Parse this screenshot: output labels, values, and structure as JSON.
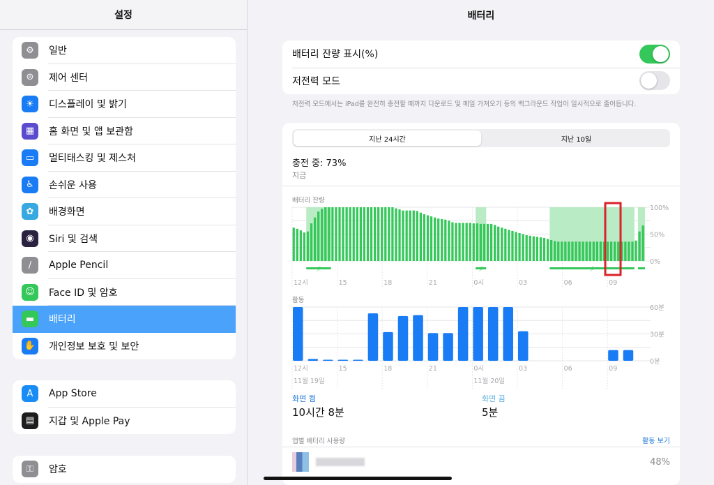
{
  "sidebar": {
    "title": "설정",
    "groups": [
      {
        "items": [
          {
            "label": "일반",
            "icon": "gear-icon",
            "color": "#8e8e93",
            "glyph": "⚙"
          },
          {
            "label": "제어 센터",
            "icon": "control-center-icon",
            "color": "#8e8e93",
            "glyph": "⊜"
          },
          {
            "label": "디스플레이 및 밝기",
            "icon": "brightness-icon",
            "color": "#1a7cf5",
            "glyph": "☀"
          },
          {
            "label": "홈 화면 및 앱 보관함",
            "icon": "home-screen-icon",
            "color": "#5b4ccf",
            "glyph": "▦"
          },
          {
            "label": "멀티태스킹 및 제스처",
            "icon": "multitasking-icon",
            "color": "#1a7cf5",
            "glyph": "▭"
          },
          {
            "label": "손쉬운 사용",
            "icon": "accessibility-icon",
            "color": "#1a7cf5",
            "glyph": "♿"
          },
          {
            "label": "배경화면",
            "icon": "wallpaper-icon",
            "color": "#38a9e0",
            "glyph": "✿"
          },
          {
            "label": "Siri 및 검색",
            "icon": "siri-icon",
            "color": "#2b2240",
            "glyph": "◉"
          },
          {
            "label": "Apple Pencil",
            "icon": "pencil-icon",
            "color": "#8e8e93",
            "glyph": "/"
          },
          {
            "label": "Face ID 및 암호",
            "icon": "face-id-icon",
            "color": "#34c759",
            "glyph": "☺"
          },
          {
            "label": "배터리",
            "icon": "battery-icon",
            "color": "#34c759",
            "glyph": "▬",
            "selected": true
          },
          {
            "label": "개인정보 보호 및 보안",
            "icon": "hand-icon",
            "color": "#1a7cf5",
            "glyph": "✋"
          }
        ]
      },
      {
        "items": [
          {
            "label": "App Store",
            "icon": "app-store-icon",
            "color": "#1a8cf5",
            "glyph": "A"
          },
          {
            "label": "지갑 및 Apple Pay",
            "icon": "wallet-icon",
            "color": "#1c1c1e",
            "glyph": "▤"
          }
        ]
      },
      {
        "items": [
          {
            "label": "암호",
            "icon": "key-icon",
            "color": "#8e8e93",
            "glyph": "⚿"
          }
        ]
      }
    ]
  },
  "main": {
    "title": "배터리",
    "toggles": [
      {
        "label": "배터리 잔량 표시(%)",
        "on": true
      },
      {
        "label": "저전력 모드",
        "on": false
      }
    ],
    "low_power_note": "저전력 모드에서는 iPad를 완전히 충전할 때까지 다운로드 및 메일 가져오기 등의 백그라운드 작업이 일시적으로 줄어듭니다.",
    "tabs": [
      {
        "label": "지난 24시간",
        "active": true
      },
      {
        "label": "지난 10일",
        "active": false
      }
    ],
    "status": {
      "title": "충전 중: 73%",
      "subtitle": "지금"
    },
    "battery_chart_label": "배터리 잔량",
    "activity_chart_label": "활동",
    "date_labels": [
      "11월 19일",
      "11월 20일"
    ],
    "stats": [
      {
        "label": "화면 켬",
        "value": "10시간 8분",
        "color": "#1e78d8"
      },
      {
        "label": "화면 끔",
        "value": "5분",
        "color": "#5ab0e0"
      }
    ],
    "app_usage": {
      "header": "앱별 배터리 사용량",
      "link": "활동 보기",
      "apps": [
        {
          "name": "",
          "percent": "48%"
        }
      ]
    }
  },
  "chart_data": [
    {
      "type": "bar",
      "title": "배터리 잔량",
      "x_ticks": [
        "12시",
        "15",
        "18",
        "21",
        "0시",
        "03",
        "06",
        "09"
      ],
      "y_ticks": [
        "100%",
        "50%",
        "0%"
      ],
      "ylim": [
        0,
        100
      ],
      "color": "#34c759",
      "charging_color": "#b9ebc4",
      "charging_periods": [
        [
          4,
          11
        ],
        [
          52,
          55
        ],
        [
          73,
          97
        ],
        [
          98,
          100
        ]
      ],
      "values": [
        62,
        60,
        57,
        53,
        55,
        70,
        81,
        92,
        97,
        100,
        100,
        100,
        100,
        100,
        100,
        100,
        100,
        100,
        100,
        100,
        100,
        100,
        100,
        100,
        100,
        100,
        100,
        100,
        100,
        98,
        96,
        94,
        94,
        94,
        94,
        93,
        90,
        87,
        85,
        83,
        81,
        79,
        78,
        77,
        75,
        72,
        71,
        71,
        71,
        71,
        71,
        70,
        70,
        69,
        69,
        69,
        69,
        67,
        64,
        62,
        60,
        58,
        56,
        54,
        52,
        50,
        48,
        47,
        46,
        45,
        44,
        43,
        41,
        39,
        37,
        36,
        36,
        36,
        36,
        36,
        36,
        36,
        36,
        36,
        36,
        36,
        36,
        36,
        36,
        36,
        36,
        36,
        36,
        36,
        36,
        36,
        36,
        38,
        55,
        66
      ]
    },
    {
      "type": "bar",
      "title": "활동",
      "x_ticks": [
        "12시",
        "15",
        "18",
        "21",
        "0시",
        "03",
        "06",
        "09"
      ],
      "y_ticks": [
        "60분",
        "30분",
        "0분"
      ],
      "ylim": [
        0,
        60
      ],
      "color": "#1a7cf5",
      "categories": [
        "12",
        "13",
        "14",
        "15",
        "16",
        "17",
        "18",
        "19",
        "20",
        "21",
        "22",
        "23",
        "0",
        "1",
        "2",
        "3",
        "4",
        "5",
        "6",
        "7",
        "8",
        "9",
        "10"
      ],
      "values": [
        60,
        2,
        1,
        1,
        1,
        53,
        32,
        50,
        51,
        31,
        31,
        60,
        60,
        60,
        60,
        33,
        0,
        0,
        0,
        0,
        0,
        12,
        12
      ]
    }
  ]
}
